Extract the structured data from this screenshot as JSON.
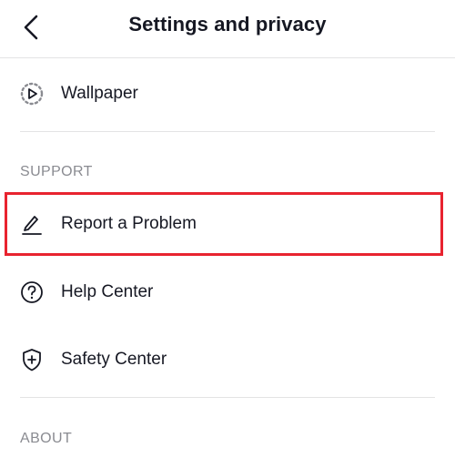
{
  "header": {
    "title": "Settings and privacy",
    "back_icon": "chevron-left-icon"
  },
  "rows": {
    "wallpaper": {
      "label": "Wallpaper",
      "icon": "wallpaper-icon"
    },
    "report": {
      "label": "Report a Problem",
      "icon": "pencil-icon"
    },
    "help": {
      "label": "Help Center",
      "icon": "question-circle-icon"
    },
    "safety": {
      "label": "Safety Center",
      "icon": "shield-plus-icon"
    }
  },
  "sections": {
    "support": "SUPPORT",
    "about": "ABOUT"
  },
  "colors": {
    "text": "#161823",
    "muted": "#8a8b91",
    "divider": "#e3e3e4",
    "highlight": "#e8232f"
  }
}
